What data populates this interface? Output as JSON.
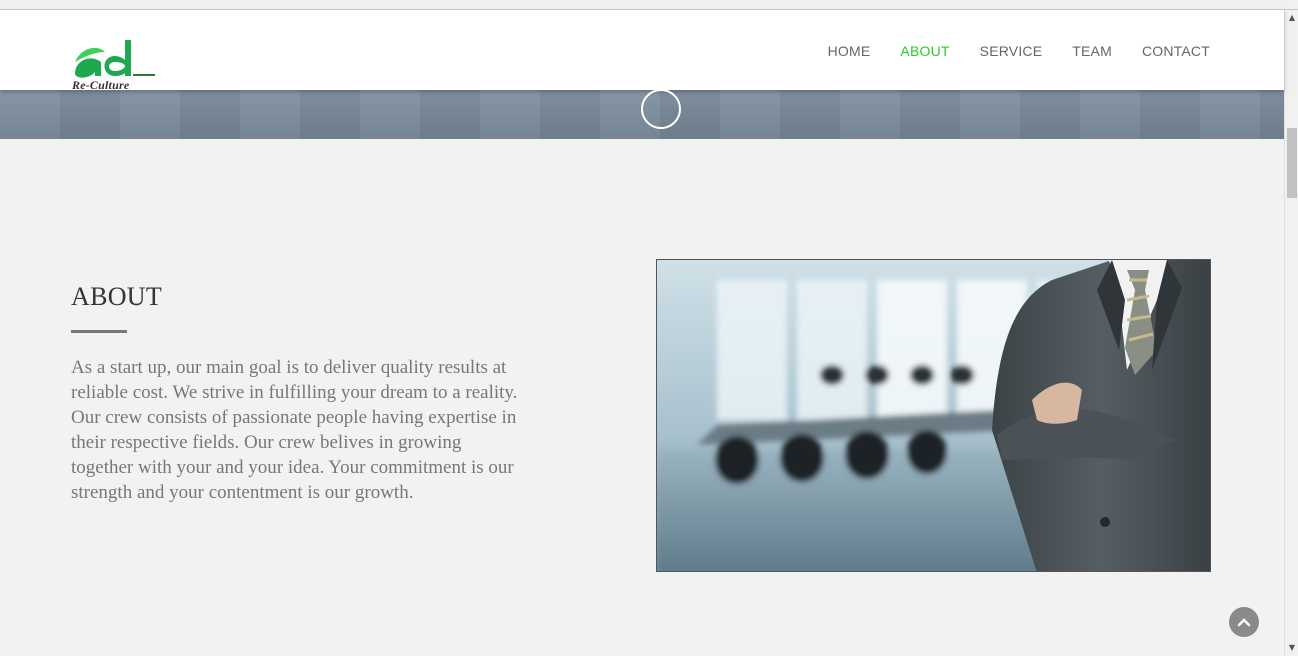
{
  "brand": {
    "logo_text": "ad",
    "logo_subtitle": "Re-Culture",
    "logo_color": "#1fa84f"
  },
  "nav": {
    "items": [
      {
        "label": "HOME",
        "active": false
      },
      {
        "label": "ABOUT",
        "active": true
      },
      {
        "label": "SERVICE",
        "active": false
      },
      {
        "label": "TEAM",
        "active": false
      },
      {
        "label": "CONTACT",
        "active": false
      }
    ],
    "active_color": "#2ec92e"
  },
  "about": {
    "title": "ABOUT",
    "body": "As a start up, our main goal is to deliver quality results at reliable cost. We strive in fulfilling your dream to a reality. Our crew consists of passionate people having expertise in their respective fields. Our crew belives in growing together with your and your idea. Your commitment is our strength and your contentment is our growth.",
    "image_subject": "businessman-with-crossed-arms-in-meeting-room"
  },
  "controls": {
    "back_to_top_icon": "chevron-up-icon",
    "hero_indicator_icon": "circle-icon"
  }
}
